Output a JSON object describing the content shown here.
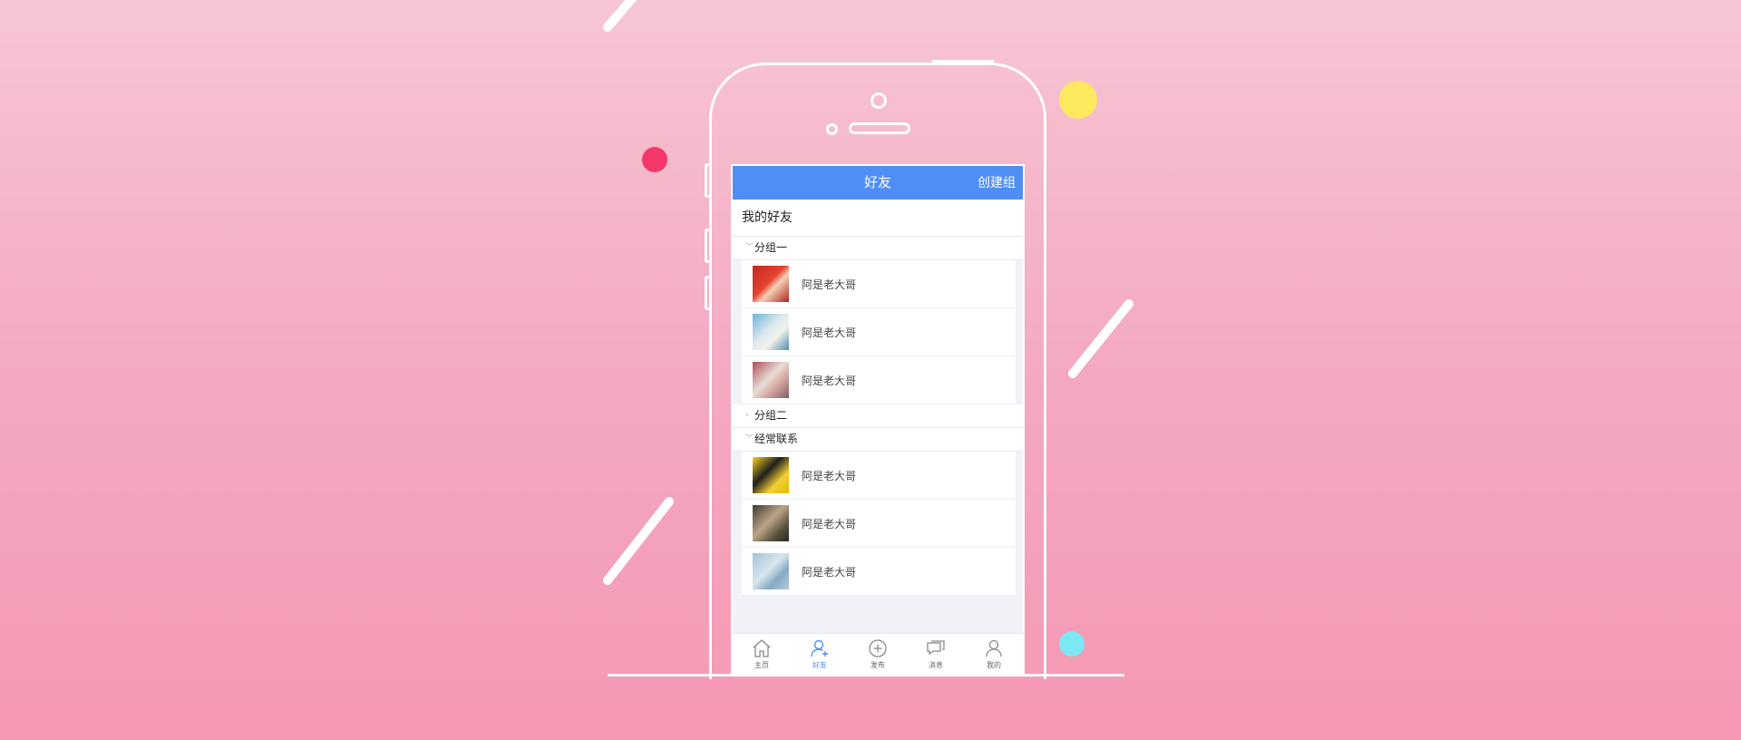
{
  "nav": {
    "title": "好友",
    "action": "创建组"
  },
  "section": {
    "title": "我的好友"
  },
  "groups": [
    {
      "name": "分组一",
      "expanded": true,
      "friends": [
        {
          "name": "阿是老大哥"
        },
        {
          "name": "阿是老大哥"
        },
        {
          "name": "阿是老大哥"
        }
      ]
    },
    {
      "name": "分组二",
      "expanded": false,
      "friends": []
    },
    {
      "name": "经常联系",
      "expanded": true,
      "friends": [
        {
          "name": "阿是老大哥"
        },
        {
          "name": "阿是老大哥"
        },
        {
          "name": "阿是老大哥"
        }
      ]
    }
  ],
  "tabs": [
    {
      "label": "主页",
      "icon": "home-icon"
    },
    {
      "label": "好友",
      "icon": "add-friend-icon",
      "active": true
    },
    {
      "label": "发布",
      "icon": "plus-circle-icon"
    },
    {
      "label": "消息",
      "icon": "message-icon"
    },
    {
      "label": "我的",
      "icon": "user-icon"
    }
  ],
  "colors": {
    "accent": "#4f8ef5",
    "background_top": "#f6c6d4",
    "background_bottom": "#f598b3"
  }
}
